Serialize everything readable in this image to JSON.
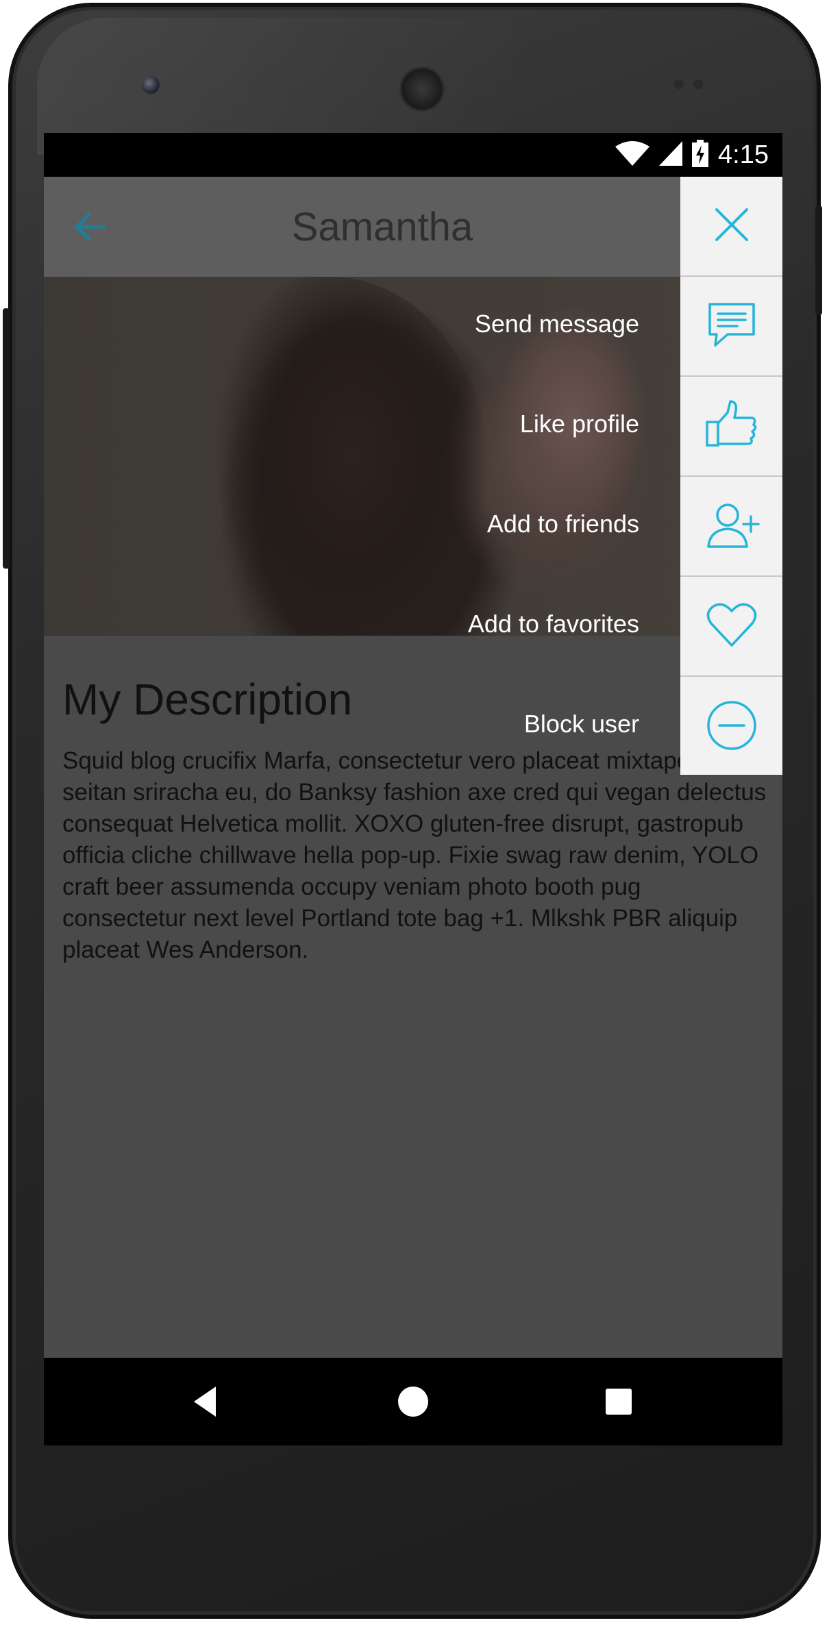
{
  "status_bar": {
    "time": "4:15",
    "wifi_icon": "wifi-icon",
    "signal_icon": "cell-signal-icon",
    "battery_icon": "battery-charging-icon"
  },
  "app_bar": {
    "title": "Samantha",
    "back_icon": "arrow-back-icon"
  },
  "description": {
    "title": "My Description",
    "body": "Squid blog crucifix Marfa, consectetur vero placeat mixtape. Non seitan sriracha eu, do Banksy fashion axe cred qui vegan delectus consequat Helvetica mollit. XOXO gluten-free disrupt, gastropub officia cliche chillwave hella pop-up. Fixie swag raw denim, YOLO craft beer assumenda occupy veniam photo booth pug consectetur next level Portland tote bag +1. Mlkshk PBR aliquip placeat Wes Anderson."
  },
  "menu": {
    "close_icon": "close-icon",
    "items": [
      {
        "label": "Send message",
        "icon": "chat-bubble-icon"
      },
      {
        "label": "Like profile",
        "icon": "thumbs-up-icon"
      },
      {
        "label": "Add to friends",
        "icon": "add-user-icon"
      },
      {
        "label": "Add to favorites",
        "icon": "heart-icon"
      },
      {
        "label": "Block user",
        "icon": "minus-circle-icon"
      }
    ]
  },
  "nav_bar": {
    "back_icon": "nav-back-icon",
    "home_icon": "nav-home-icon",
    "recents_icon": "nav-recents-icon"
  },
  "colors": {
    "accent": "#26b5d8",
    "screen_overlay": "#4a4a4a",
    "menu_background": "#f2f2f2"
  }
}
